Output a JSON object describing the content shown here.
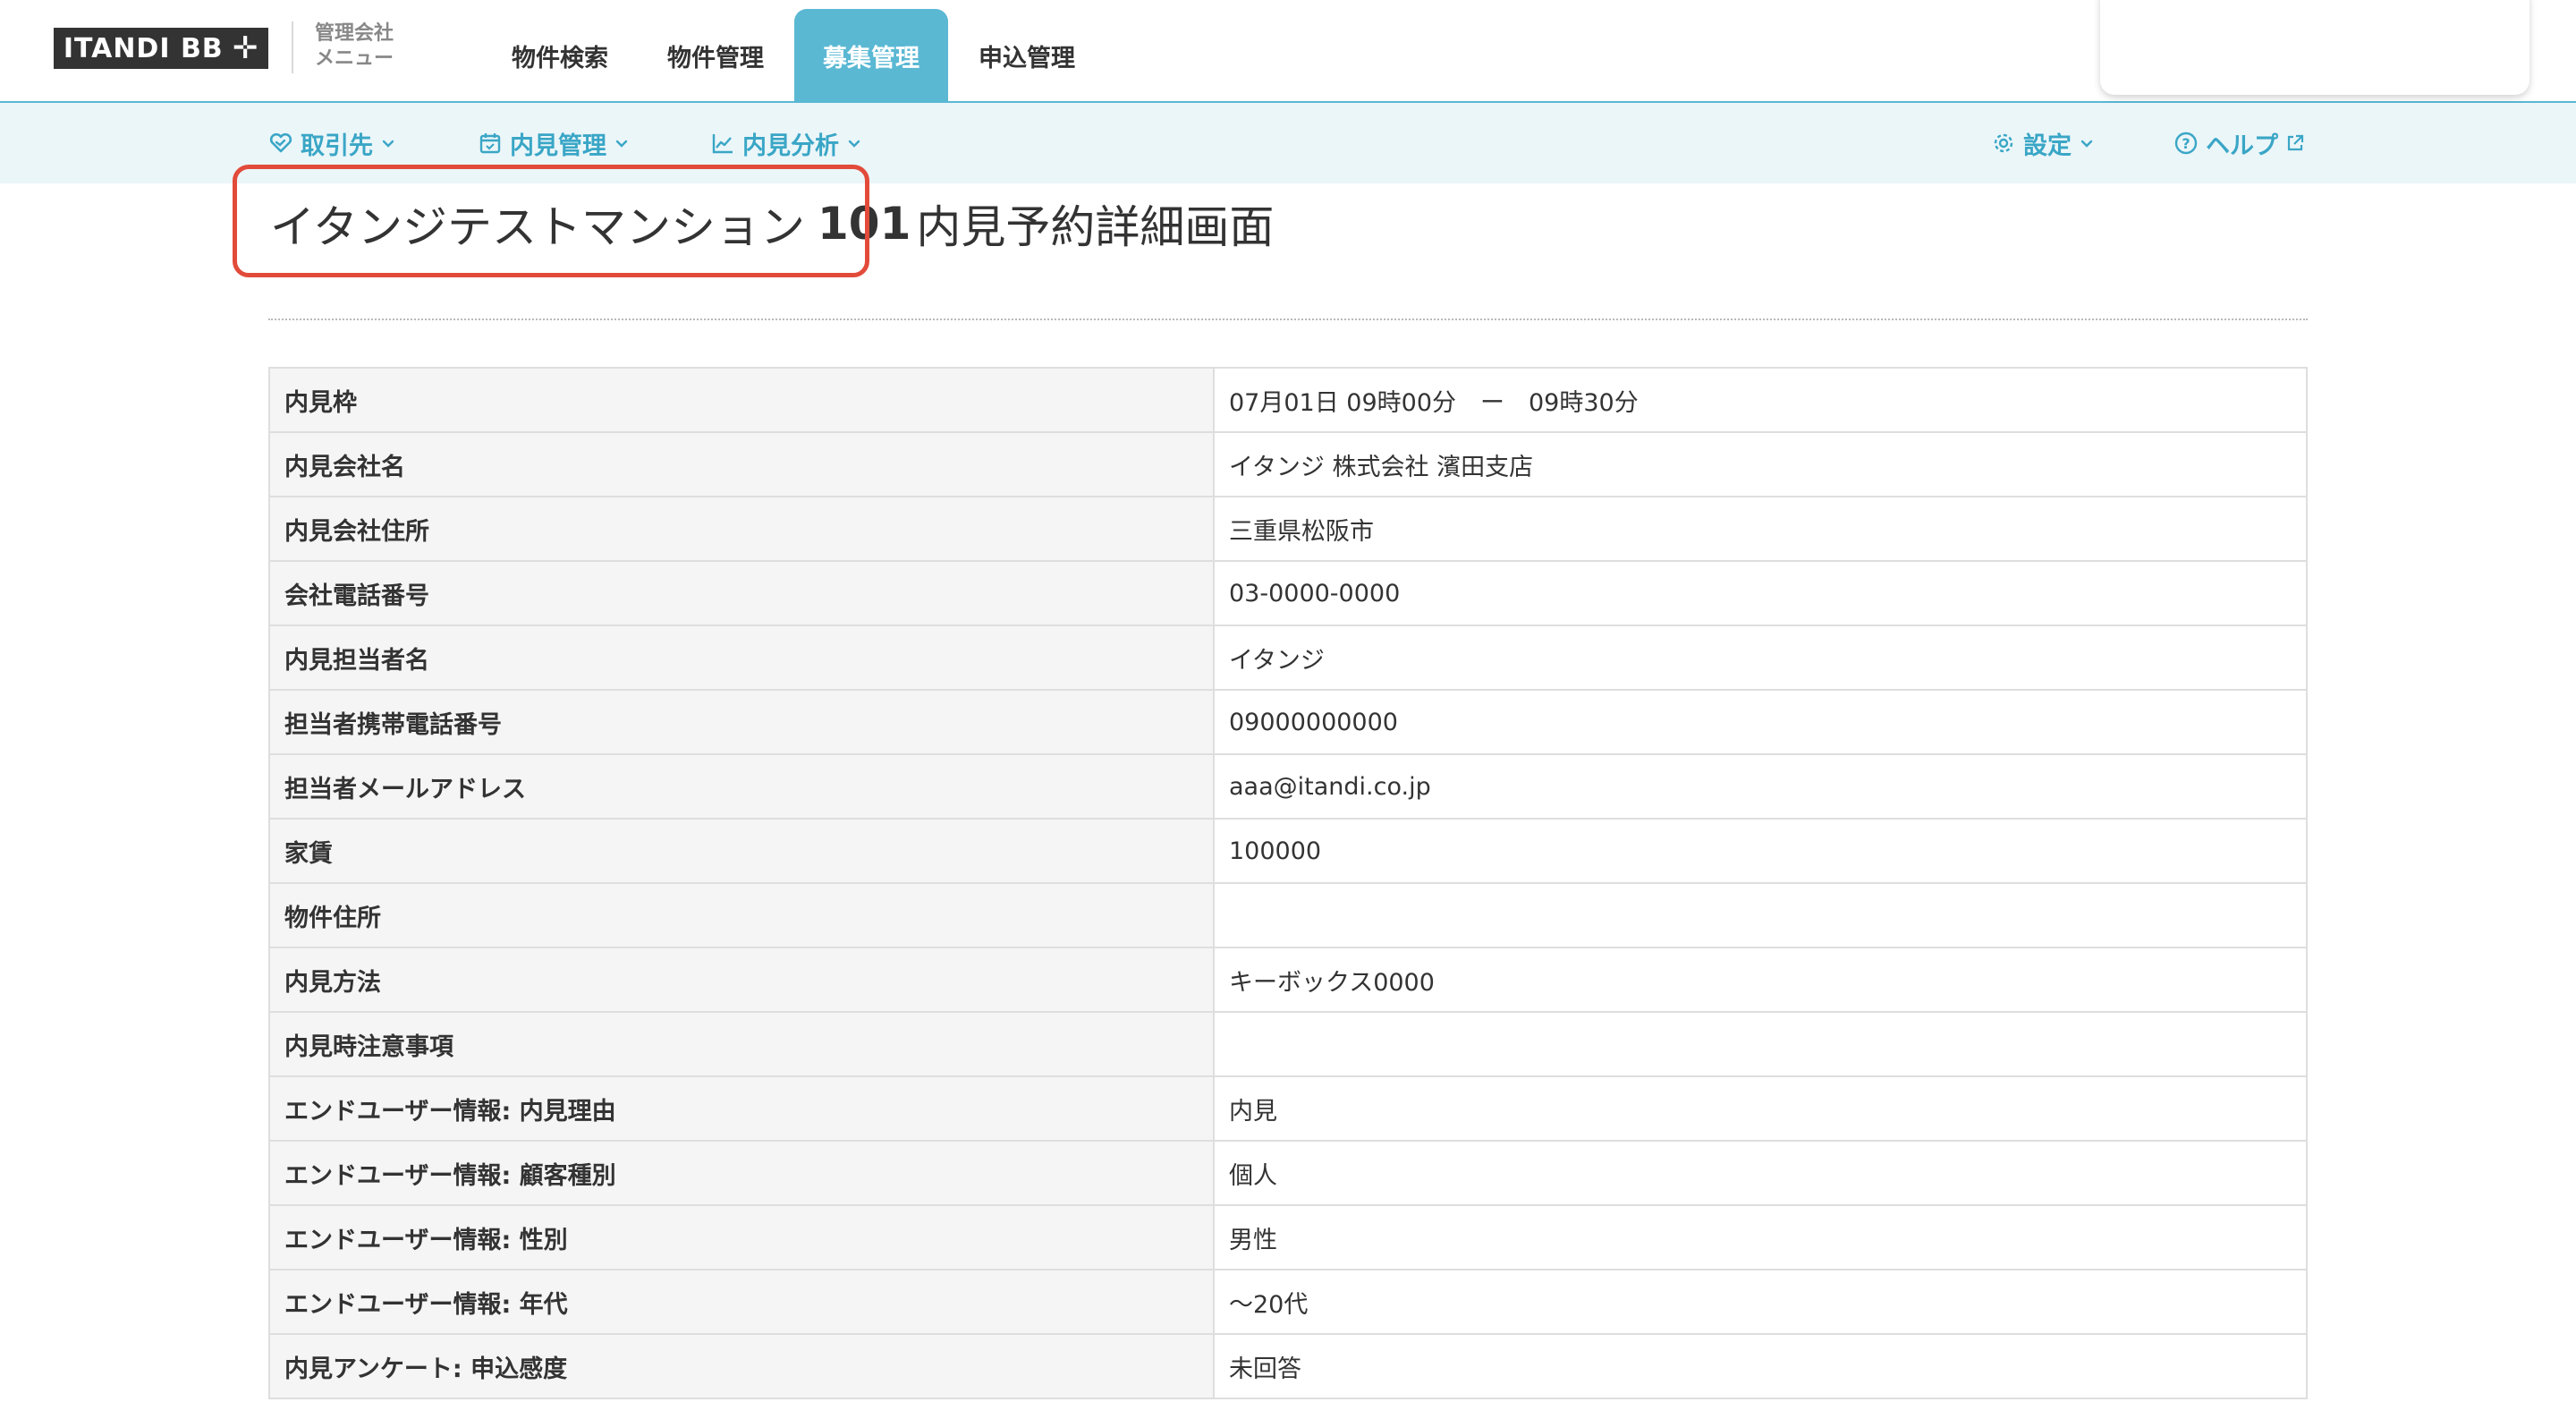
{
  "header": {
    "logo_text": "ITANDI BB",
    "logo_symbol": "✛",
    "menu_label": "管理会社\nメニュー",
    "nav": [
      {
        "label": "物件検索",
        "active": false
      },
      {
        "label": "物件管理",
        "active": false
      },
      {
        "label": "募集管理",
        "active": true
      },
      {
        "label": "申込管理",
        "active": false
      }
    ]
  },
  "subnav": {
    "left": [
      {
        "label": "取引先",
        "icon": "handshake-icon"
      },
      {
        "label": "内見管理",
        "icon": "calendar-icon"
      },
      {
        "label": "内見分析",
        "icon": "line-chart-icon"
      }
    ],
    "settings_label": "設定",
    "help_label": "ヘルプ"
  },
  "page": {
    "title_name": "イタンジテストマンション",
    "title_room": "101",
    "title_suffix": "内見予約詳細画面"
  },
  "details": [
    {
      "label": "内見枠",
      "value": "07月01日 09時00分　ー　09時30分"
    },
    {
      "label": "内見会社名",
      "value": "イタンジ 株式会社 濱田支店"
    },
    {
      "label": "内見会社住所",
      "value": "三重県松阪市"
    },
    {
      "label": "会社電話番号",
      "value": "03-0000-0000"
    },
    {
      "label": "内見担当者名",
      "value": "イタンジ"
    },
    {
      "label": "担当者携帯電話番号",
      "value": "09000000000"
    },
    {
      "label": "担当者メールアドレス",
      "value": "aaa@itandi.co.jp"
    },
    {
      "label": "家賃",
      "value": "100000"
    },
    {
      "label": "物件住所",
      "value": ""
    },
    {
      "label": "内見方法",
      "value": "キーボックス0000"
    },
    {
      "label": "内見時注意事項",
      "value": ""
    },
    {
      "label": "エンドユーザー情報: 内見理由",
      "value": "内見"
    },
    {
      "label": "エンドユーザー情報: 顧客種別",
      "value": "個人"
    },
    {
      "label": "エンドユーザー情報: 性別",
      "value": "男性"
    },
    {
      "label": "エンドユーザー情報: 年代",
      "value": "〜20代"
    },
    {
      "label": "内見アンケート: 申込感度",
      "value": "未回答"
    }
  ],
  "colors": {
    "accent": "#5ab8d3",
    "subnav_text": "#3aa6c6",
    "subnav_bg": "#ebf6f9",
    "highlight": "#e24b3a"
  }
}
